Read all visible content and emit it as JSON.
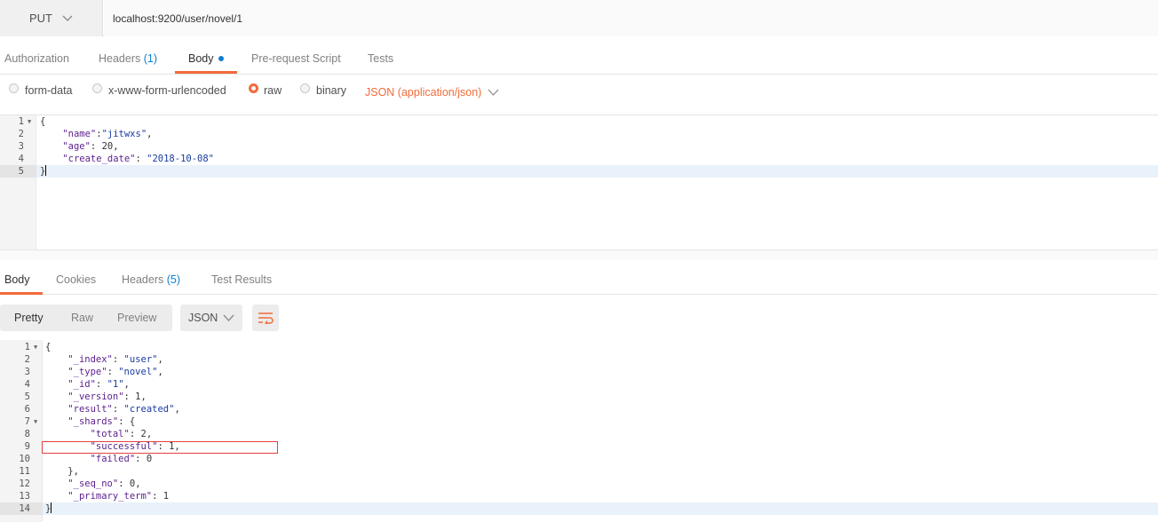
{
  "request": {
    "method": "PUT",
    "url": "localhost:9200/user/novel/1"
  },
  "request_tabs": [
    {
      "label": "Authorization",
      "count": ""
    },
    {
      "label": "Headers",
      "count": "(1)"
    },
    {
      "label": "Body",
      "count": ""
    },
    {
      "label": "Pre-request Script",
      "count": ""
    },
    {
      "label": "Tests",
      "count": ""
    }
  ],
  "body_type": {
    "options": [
      "form-data",
      "x-www-form-urlencoded",
      "raw",
      "binary"
    ],
    "selected": "raw",
    "content_type": "JSON (application/json)"
  },
  "request_body_lines": [
    "{",
    "    \"name\":\"jitwxs\",",
    "    \"age\": 20,",
    "    \"create_date\": \"2018-10-08\"",
    "}"
  ],
  "response_tabs": [
    {
      "label": "Body",
      "count": ""
    },
    {
      "label": "Cookies",
      "count": ""
    },
    {
      "label": "Headers",
      "count": "(5)"
    },
    {
      "label": "Test Results",
      "count": ""
    }
  ],
  "response_view": {
    "modes": [
      "Pretty",
      "Raw",
      "Preview"
    ],
    "selected_mode": "Pretty",
    "format": "JSON"
  },
  "response_body_lines": [
    "{",
    "    \"_index\": \"user\",",
    "    \"_type\": \"novel\",",
    "    \"_id\": \"1\",",
    "    \"_version\": 1,",
    "    \"result\": \"created\",",
    "    \"_shards\": {",
    "        \"total\": 2,",
    "        \"successful\": 1,",
    "        \"failed\": 0",
    "    },",
    "    \"_seq_no\": 0,",
    "    \"_primary_term\": 1",
    "}"
  ],
  "colors": {
    "accent": "#f26b3a",
    "link": "#0f7fd0",
    "highlight": "#e0413f"
  }
}
